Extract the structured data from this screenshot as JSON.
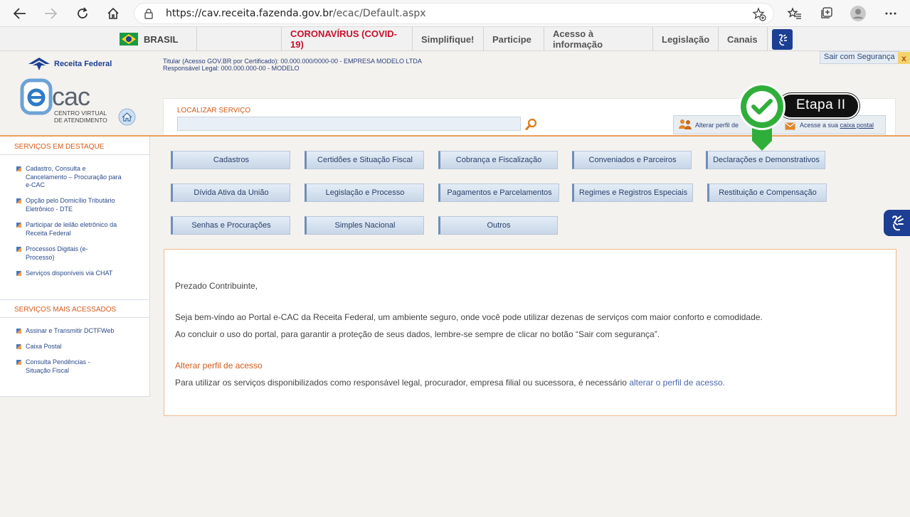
{
  "browser": {
    "url_host": "https://cav.receita.fazenda.gov.br",
    "url_path": "/ecac/Default.aspx"
  },
  "govbar": {
    "brasil": "BRASIL",
    "links": [
      "CORONAVÍRUS (COVID-19)",
      "Simplifique!",
      "Participe",
      "Acesso à informação",
      "Legislação",
      "Canais"
    ]
  },
  "header": {
    "rf_logo": "Receita Federal",
    "ecac_sub1": "CENTRO VIRTUAL",
    "ecac_sub2": "DE ATENDIMENTO",
    "titular_line1": "Titular (Acesso GOV.BR por Certificado): 00.000.000/0000-00 - EMPRESA MODELO LTDA",
    "titular_line2": "Responsável Legal: 000.000.000-00 - MODELO",
    "sair": "Sair com Segurança",
    "sair_close": "x",
    "search_label": "LOCALIZAR SERVIÇO",
    "search_value": "",
    "perfil_text": "Alterar perfil de",
    "caixa_prefix": "Acesse a sua ",
    "caixa_link": "caixa postal"
  },
  "annotation": {
    "label": "Etapa II"
  },
  "sidebar": {
    "destaque_title": "SERVIÇOS EM DESTAQUE",
    "destaque": [
      "Cadastro, Consulta e Cancelamento – Procuração para e-CAC",
      "Opção pelo Domicílio Tributário Eletrônico - DTE",
      "Participar de leilão eletrônico da Receita Federal",
      "Processos Digitais (e-Processo)",
      "Serviços disponíveis via CHAT"
    ],
    "acessados_title": "SERVIÇOS MAIS ACESSADOS",
    "acessados": [
      "Assinar e Transmitir DCTFWeb",
      "Caixa Postal",
      "Consulta Pendências - Situação Fiscal"
    ]
  },
  "categories": [
    "Cadastros",
    "Certidões e Situação Fiscal",
    "Cobrança e Fiscalização",
    "Conveniados e Parceiros",
    "Declarações e Demonstrativos",
    "Dívida Ativa da União",
    "Legislação e Processo",
    "Pagamentos e Parcelamentos",
    "Regimes e Registros Especiais",
    "Restituição e Compensação",
    "Senhas e Procurações",
    "Simples Nacional",
    "Outros"
  ],
  "content": {
    "greeting": "Prezado Contribuinte,",
    "p1": "Seja bem-vindo ao Portal e-CAC da Receita Federal, um ambiente seguro, onde você pode utilizar dezenas de serviços com maior conforto e comodidade.",
    "p2": "Ao concluir o uso do portal, para garantir a proteção de seus dados, lembre-se sempre de clicar no botão “Sair com segurança”.",
    "perfil_title": "Alterar perfil de acesso",
    "p3": "Para utilizar os serviços disponibilizados como responsável legal, procurador, empresa filial ou sucessora, é necessário ",
    "p3_link": "alterar o perfil de acesso."
  }
}
